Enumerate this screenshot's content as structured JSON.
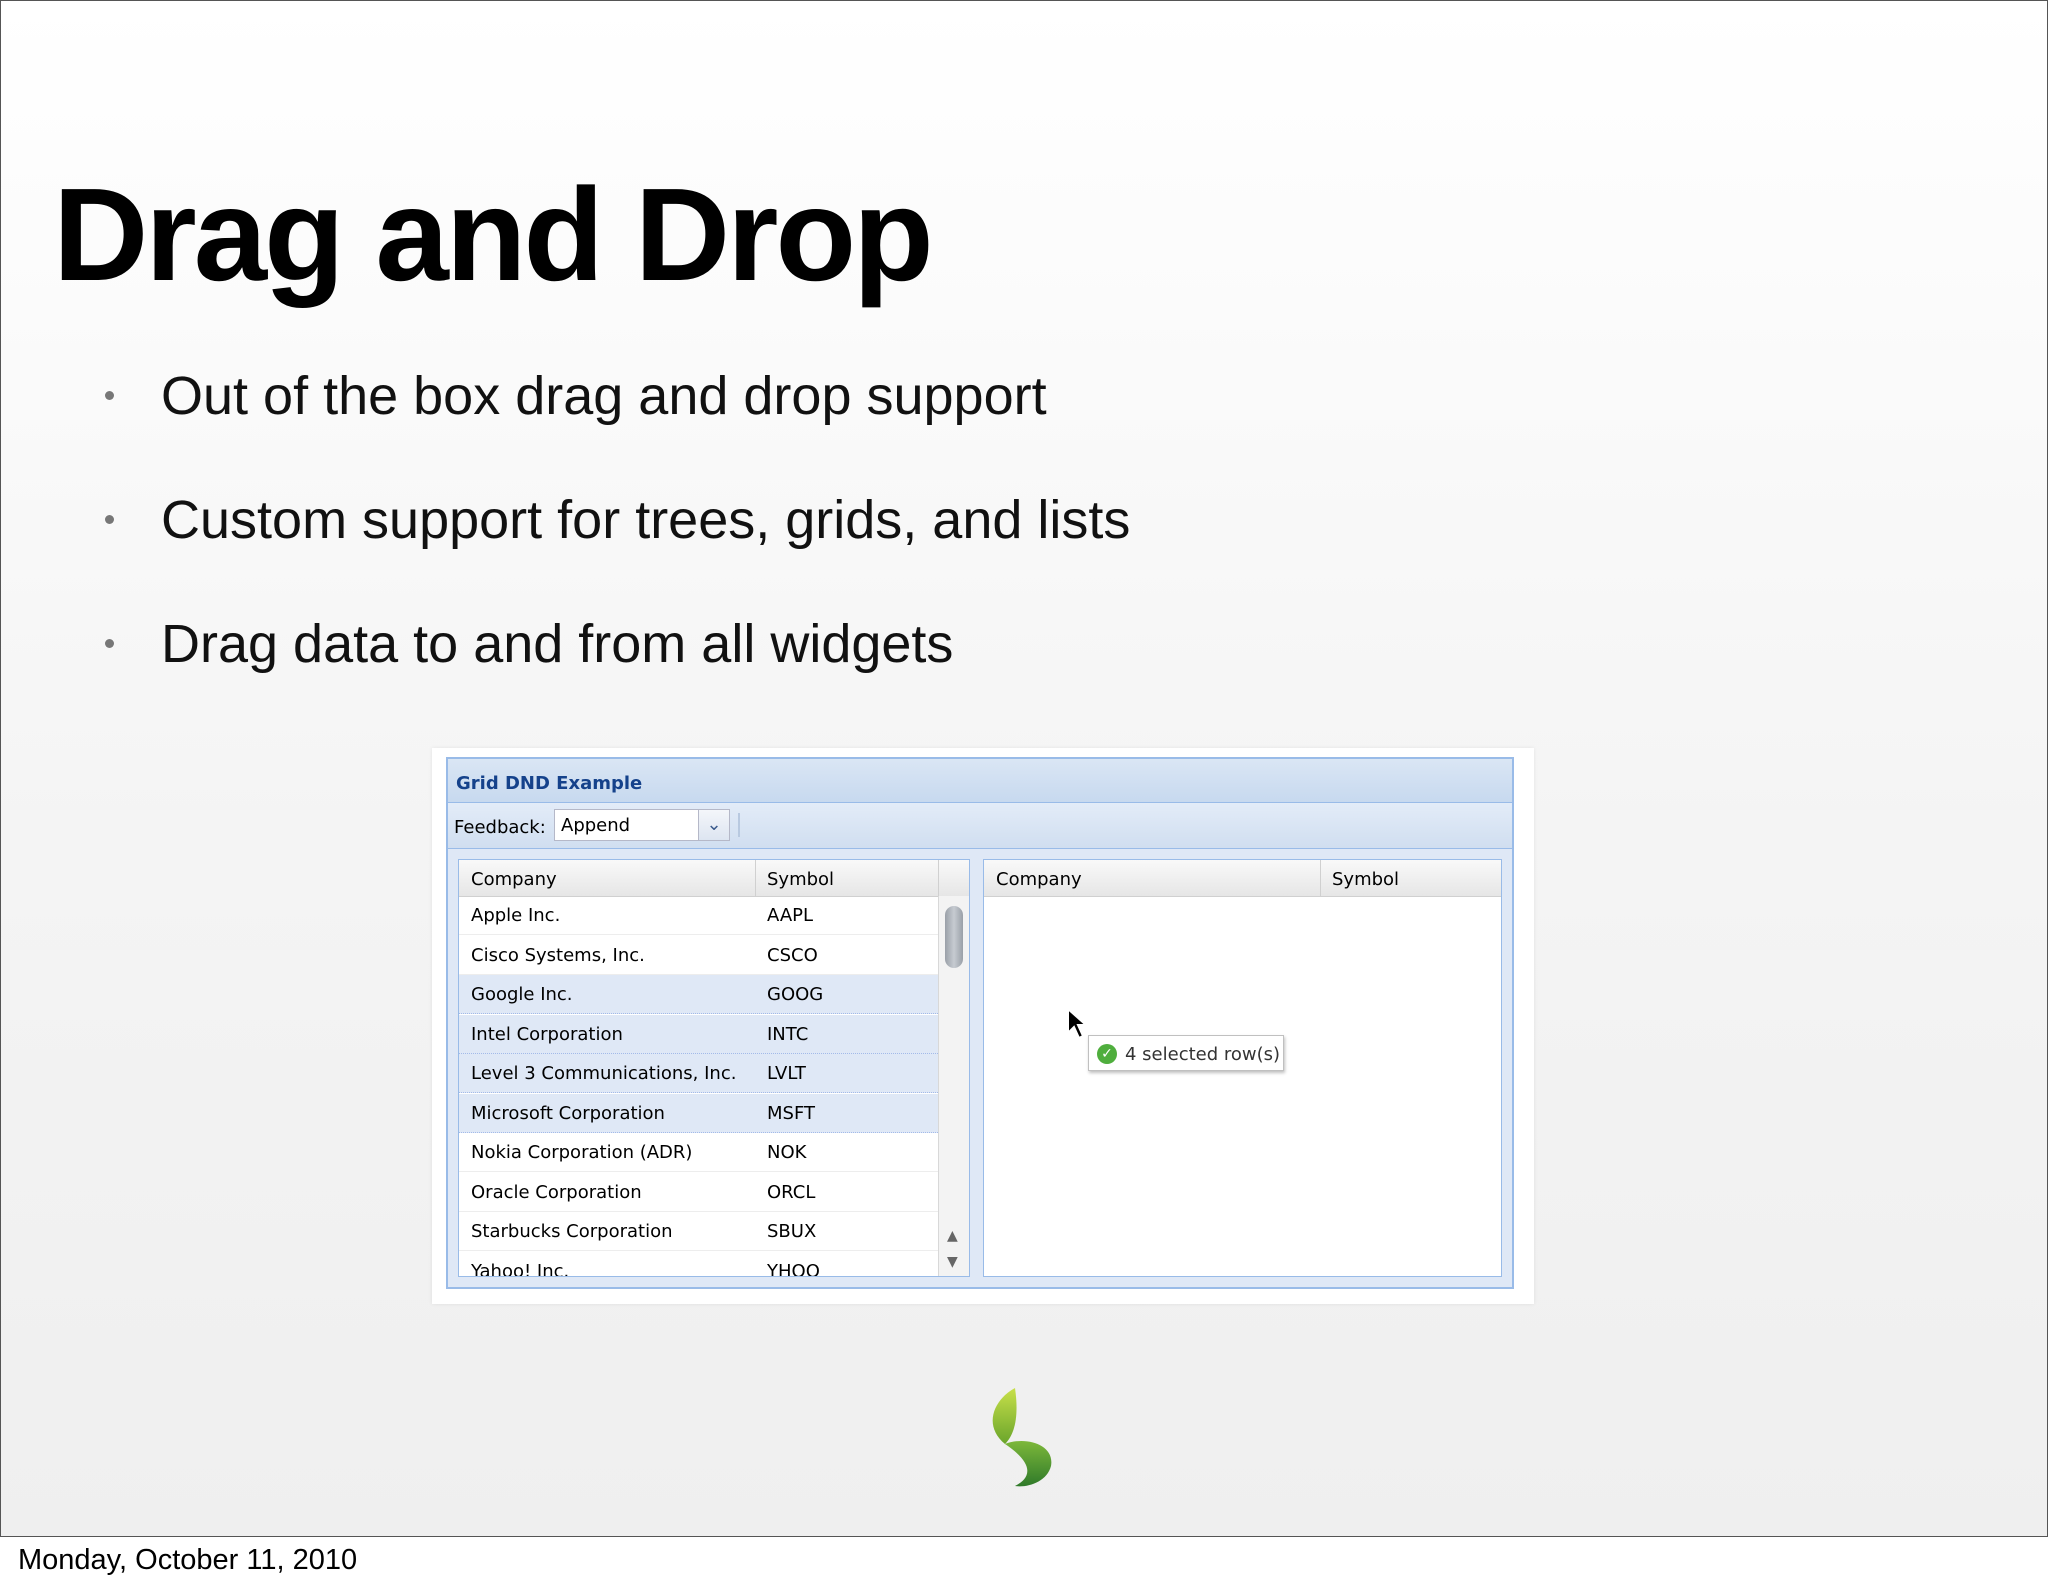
{
  "slide": {
    "title": "Drag and Drop",
    "bullets": [
      "Out of the box drag and drop support",
      "Custom support for trees, grids, and lists",
      "Drag data to and from all widgets"
    ]
  },
  "example": {
    "panel_title": "Grid DND Example",
    "toolbar": {
      "feedback_label": "Feedback:",
      "feedback_value": "Append"
    },
    "left_grid": {
      "columns": [
        "Company",
        "Symbol"
      ],
      "rows": [
        {
          "company": "Apple Inc.",
          "symbol": "AAPL",
          "selected": false
        },
        {
          "company": "Cisco Systems, Inc.",
          "symbol": "CSCO",
          "selected": false
        },
        {
          "company": "Google Inc.",
          "symbol": "GOOG",
          "selected": true
        },
        {
          "company": "Intel Corporation",
          "symbol": "INTC",
          "selected": true
        },
        {
          "company": "Level 3 Communications, Inc.",
          "symbol": "LVLT",
          "selected": true
        },
        {
          "company": "Microsoft Corporation",
          "symbol": "MSFT",
          "selected": true
        },
        {
          "company": "Nokia Corporation (ADR)",
          "symbol": "NOK",
          "selected": false
        },
        {
          "company": "Oracle Corporation",
          "symbol": "ORCL",
          "selected": false
        },
        {
          "company": "Starbucks Corporation",
          "symbol": "SBUX",
          "selected": false
        },
        {
          "company": "Yahoo! Inc.",
          "symbol": "YHOO",
          "selected": false
        }
      ]
    },
    "right_grid": {
      "columns": [
        "Company",
        "Symbol"
      ]
    },
    "drag_tip": "4 selected row(s)"
  },
  "footer": {
    "date": "Monday, October 11, 2010"
  },
  "colors": {
    "panel_border": "#99bbe8",
    "panel_title": "#15428b",
    "selected_row": "#dfe8f6",
    "logo_green": "#8cc63f"
  }
}
